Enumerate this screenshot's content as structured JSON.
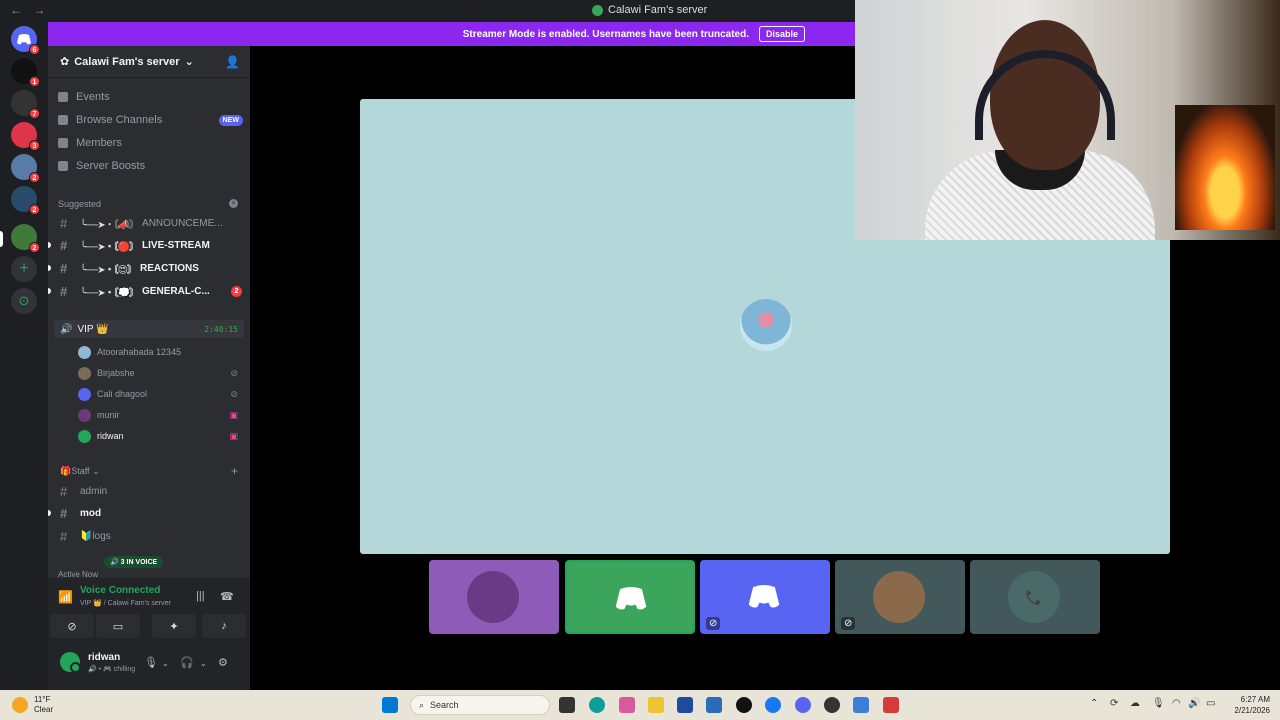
{
  "window": {
    "title": "Calawi Fam's server",
    "nav_back": "←",
    "nav_fwd": "→"
  },
  "banner": {
    "text": "Streamer Mode is enabled. Usernames have been truncated.",
    "button": "Disable"
  },
  "rail": {
    "home_badge": "6",
    "servers": [
      {
        "badge": "1"
      },
      {
        "badge": "7"
      },
      {
        "badge": "3"
      },
      {
        "badge": "2"
      },
      {
        "badge": "2"
      },
      {
        "badge": "2"
      }
    ],
    "add_icon": "+",
    "explore_icon": "⊙"
  },
  "sidebar": {
    "server_name": "Calawi Fam's server",
    "nav": [
      {
        "label": "Events"
      },
      {
        "label": "Browse Channels",
        "badge": "NEW"
      },
      {
        "label": "Members"
      },
      {
        "label": "Server Boosts"
      }
    ],
    "suggested_label": "Suggested",
    "suggested_channels": [
      {
        "name": "ANNOUNCEME...",
        "prefix": "╰──➤・〘📣〙",
        "bold": false
      },
      {
        "name": "LIVE-STREAM",
        "prefix": "╰──➤・〘🔴〙",
        "bold": true
      },
      {
        "name": "REACTIONS",
        "prefix": "╰──➤・〘😍〙",
        "bold": true
      },
      {
        "name": "GENERAL-C...",
        "prefix": "╰──➤・〘💭〙",
        "bold": true,
        "count": "2"
      }
    ],
    "voice_channel": {
      "name": "VIP 👑",
      "timer": "2:40:15"
    },
    "voice_users": [
      {
        "name": "Atoorahabada 12345",
        "status": ""
      },
      {
        "name": "Birjabshe",
        "status": "⊘"
      },
      {
        "name": "Cali dhagool",
        "status": "⊘"
      },
      {
        "name": "munir",
        "status": "▣"
      },
      {
        "name": "ridwan",
        "status": "▣"
      }
    ],
    "staff_label": "🎁Staff",
    "staff_channels": [
      {
        "name": "admin",
        "bold": false
      },
      {
        "name": "mod",
        "bold": true
      },
      {
        "name": "🔰logs",
        "bold": false
      }
    ],
    "in_voice": "🔊 3 IN VOICE",
    "active_now": "Active Now"
  },
  "voice_panel": {
    "title": "Voice Connected",
    "subtitle": "VIP 👑 / Calawi Fam's server",
    "user_name": "ridwan",
    "user_status": "🔊 • 🎮 chilling"
  },
  "taskbar": {
    "temp": "11°F",
    "condition": "Clear",
    "search_placeholder": "Search",
    "time": "6:27 AM",
    "date": "2/21/2026"
  },
  "colors": {
    "accent": "#5865f2",
    "banner": "#8c27ef",
    "voice_green": "#23a55a",
    "stage_bg": "#b4d8d9"
  }
}
